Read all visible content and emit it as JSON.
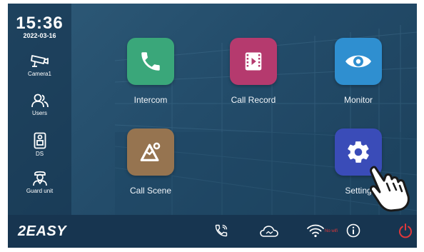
{
  "clock": {
    "time": "15:36",
    "date": "2022-03-16"
  },
  "sidebar": {
    "items": [
      {
        "label": "Camera1",
        "icon": "cctv-camera-icon"
      },
      {
        "label": "Users",
        "icon": "users-icon"
      },
      {
        "label": "DS",
        "icon": "door-station-icon"
      },
      {
        "label": "Guard unit",
        "icon": "guard-icon"
      }
    ]
  },
  "apps": [
    {
      "label": "Intercom",
      "icon": "phone-icon",
      "color": "#3aa77a"
    },
    {
      "label": "Call Record",
      "icon": "video-record-icon",
      "color": "#b53a6e"
    },
    {
      "label": "Monitor",
      "icon": "eye-icon",
      "color": "#2f8fd0"
    },
    {
      "label": "Call Scene",
      "icon": "mountain-scene-icon",
      "color": "#967450"
    },
    {
      "label": "Setting",
      "icon": "gear-icon",
      "color": "#3a4cb8"
    }
  ],
  "bottombar": {
    "logo": "2EASY",
    "wifi_status": "No wifi",
    "icons": [
      "call-log-icon",
      "cloud-icon",
      "wifi-icon",
      "info-icon",
      "power-icon"
    ],
    "power_color": "#e0373a"
  }
}
